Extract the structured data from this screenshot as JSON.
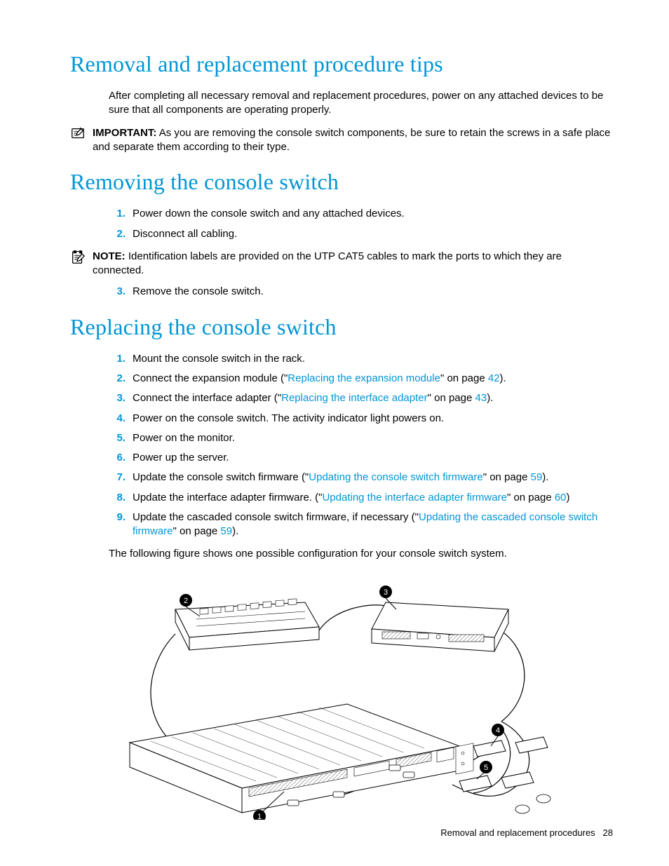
{
  "headings": {
    "h1a": "Removal and replacement procedure tips",
    "h1b": "Removing the console switch",
    "h1c": "Replacing the console switch"
  },
  "tips": {
    "intro": "After completing all necessary removal and replacement procedures, power on any attached devices to be sure that all components are operating properly.",
    "important_label": "IMPORTANT:",
    "important_text": "  As you are removing the console switch components, be sure to retain the screws in a safe place and separate them according to their type."
  },
  "removing": {
    "steps": [
      "Power down the console switch and any attached devices.",
      "Disconnect all cabling."
    ],
    "note_label": "NOTE:",
    "note_text": "  Identification labels are provided on the UTP CAT5 cables to mark the ports to which they are connected.",
    "step3": "Remove the console switch."
  },
  "replacing": {
    "s1": "Mount the console switch in the rack.",
    "s2_pre": "Connect the expansion module (\"",
    "s2_link": "Replacing the expansion module",
    "s2_mid": "\" on page ",
    "s2_page": "42",
    "s2_post": ").",
    "s3_pre": "Connect the interface adapter (\"",
    "s3_link": "Replacing the interface adapter",
    "s3_mid": "\" on page ",
    "s3_page": "43",
    "s3_post": ").",
    "s4": "Power on the console switch. The activity indicator light powers on.",
    "s5": "Power on the monitor.",
    "s6": "Power up the server.",
    "s7_pre": "Update the console switch firmware (\"",
    "s7_link": "Updating the console switch firmware",
    "s7_mid": "\" on page ",
    "s7_page": "59",
    "s7_post": ").",
    "s8_pre": "Update the interface adapter firmware. (\"",
    "s8_link": "Updating the interface adapter firmware",
    "s8_mid": "\" on page ",
    "s8_page": "60",
    "s8_post": ")",
    "s9_pre": "Update the cascaded console switch firmware, if necessary (\"",
    "s9_link": "Updating the cascaded console switch firmware",
    "s9_mid": "\" on page ",
    "s9_page": "59",
    "s9_post": ").",
    "figcap": "The following figure shows one possible configuration for your console switch system."
  },
  "footer": {
    "section": "Removal and replacement procedures",
    "page": "28"
  }
}
